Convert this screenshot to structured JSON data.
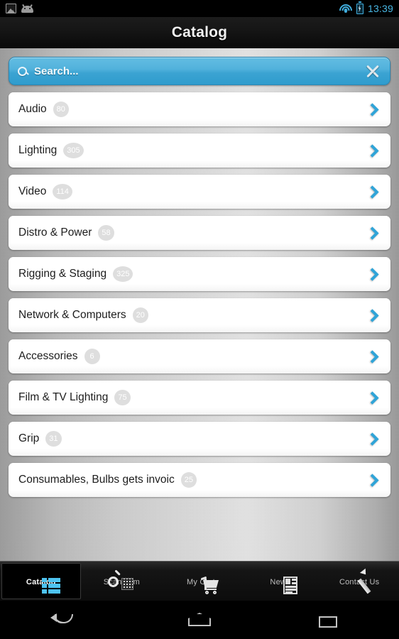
{
  "statusbar": {
    "time": "13:39",
    "icons": [
      "screenshot-image-icon",
      "android-robot-icon",
      "wifi-icon",
      "battery-charging-icon"
    ]
  },
  "header": {
    "title": "Catalog"
  },
  "search": {
    "placeholder": "Search...",
    "value": "",
    "icon": "search-icon",
    "clear_icon": "close-icon",
    "accent_color": "#52b2dc"
  },
  "list": {
    "rows": [
      {
        "label": "Audio",
        "count": "80"
      },
      {
        "label": "Lighting",
        "count": "305"
      },
      {
        "label": "Video",
        "count": "114"
      },
      {
        "label": "Distro & Power",
        "count": "58"
      },
      {
        "label": "Rigging & Staging",
        "count": "325"
      },
      {
        "label": "Network & Computers",
        "count": "20"
      },
      {
        "label": "Accessories",
        "count": "6"
      },
      {
        "label": "Film & TV Lighting",
        "count": "75"
      },
      {
        "label": "Grip",
        "count": "31"
      },
      {
        "label": "Consumables, Bulbs gets invoic",
        "count": "25"
      }
    ],
    "chevron_color": "#2fa4d8",
    "badge_color": "#dedede"
  },
  "tabbar": {
    "tabs": [
      {
        "label": "Catalog",
        "icon": "list-icon",
        "active": true
      },
      {
        "label": "Scan Item",
        "icon": "qr-scan-icon",
        "active": false
      },
      {
        "label": "My Cart",
        "icon": "cart-icon",
        "active": false
      },
      {
        "label": "News",
        "icon": "newspaper-icon",
        "active": false
      },
      {
        "label": "Contact Us",
        "icon": "pencil-icon",
        "active": false
      }
    ],
    "active_color": "#4ec3f0"
  },
  "navbar": {
    "buttons": [
      {
        "name": "back-icon"
      },
      {
        "name": "home-icon"
      },
      {
        "name": "recent-apps-icon"
      }
    ]
  }
}
